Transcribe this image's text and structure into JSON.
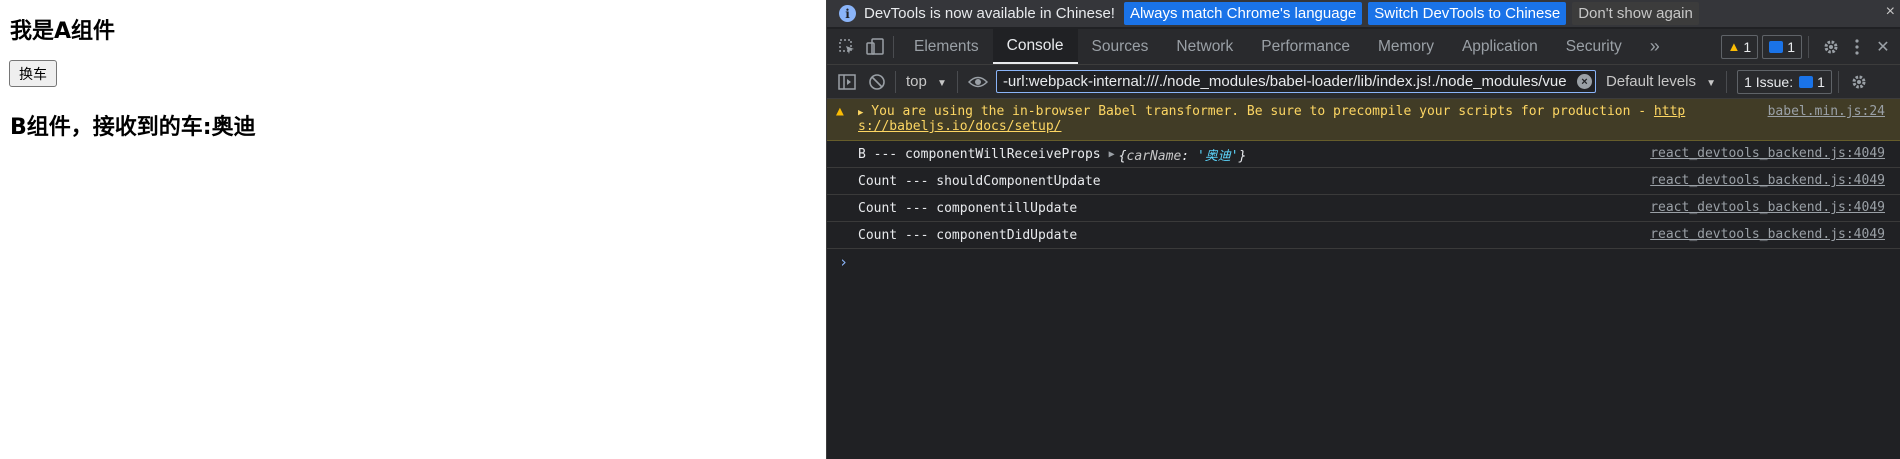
{
  "page": {
    "heading_a": "我是A组件",
    "button_label": "换车",
    "heading_b": "B组件，接收到的车:奥迪"
  },
  "devtools": {
    "notify": {
      "message": "DevTools is now available in Chinese!",
      "btn_match": "Always match Chrome's language",
      "btn_switch": "Switch DevTools to Chinese",
      "btn_dismiss": "Don't show again",
      "close": "×"
    },
    "tabs": [
      "Elements",
      "Console",
      "Sources",
      "Network",
      "Performance",
      "Memory",
      "Application",
      "Security"
    ],
    "more_tabs": "»",
    "warn_count": "1",
    "msg_count": "1",
    "toolbar": {
      "context": "top",
      "filter_value": "-url:webpack-internal:///./node_modules/babel-loader/lib/index.js!./node_modules/vue",
      "levels": "Default levels",
      "issues": "1 Issue:",
      "issues_count": "1"
    },
    "console": {
      "warning": {
        "text1": "You are using the in-browser Babel transformer. Be sure to precompile your scripts for production - ",
        "link1": "http",
        "link2": "s://babeljs.io/docs/setup/",
        "source": "babel.min.js:24"
      },
      "logs": [
        {
          "text": "B --- componentWillReceiveProps",
          "obj_key": "carName",
          "obj_val": "'奥迪'",
          "source": "react_devtools_backend.js:4049"
        },
        {
          "text": "Count --- shouldComponentUpdate",
          "source": "react_devtools_backend.js:4049"
        },
        {
          "text": "Count --- componentillUpdate",
          "source": "react_devtools_backend.js:4049"
        },
        {
          "text": "Count --- componentDidUpdate",
          "source": "react_devtools_backend.js:4049"
        }
      ],
      "prompt": "›"
    }
  },
  "colors": {
    "devtools_bg": "#202124",
    "accent": "#1a73e8",
    "warning_bg": "#413c26",
    "warning_text": "#fdd663"
  }
}
